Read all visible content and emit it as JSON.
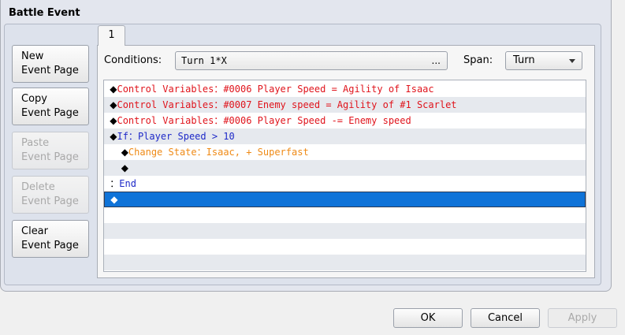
{
  "group_title": "Battle Event",
  "side_buttons": [
    {
      "line1": "New",
      "line2": "Event Page"
    },
    {
      "line1": "Copy",
      "line2": "Event Page"
    },
    {
      "line1": "Paste",
      "line2": "Event Page"
    },
    {
      "line1": "Delete",
      "line2": "Event Page"
    },
    {
      "line1": "Clear",
      "line2": "Event Page"
    }
  ],
  "tab_label": "1",
  "conditions": {
    "label": "Conditions:",
    "value": "Turn 1*X",
    "dots": "..."
  },
  "span": {
    "label": "Span:",
    "value": "Turn"
  },
  "commands": [
    {
      "indent": "",
      "marker": "◆",
      "head": "Control Variables",
      "sep": "：",
      "body": "#0006 Player Speed = Agility of Isaac",
      "color": "red"
    },
    {
      "indent": "",
      "marker": "◆",
      "head": "Control Variables",
      "sep": "：",
      "body": "#0007 Enemy speed = Agility of #1 Scarlet",
      "color": "red"
    },
    {
      "indent": "",
      "marker": "◆",
      "head": "Control Variables",
      "sep": "：",
      "body": "#0006 Player Speed -= Enemy speed",
      "color": "red"
    },
    {
      "indent": "",
      "marker": "◆",
      "head": "If",
      "sep": "：",
      "body": "Player Speed > 10",
      "color": "blue"
    },
    {
      "indent": " ",
      "marker": "◆",
      "head": "Change State",
      "sep": "：",
      "body": "Isaac, + Superfast",
      "color": "orange"
    },
    {
      "indent": " ",
      "marker": "◆",
      "head": "",
      "sep": "",
      "body": "",
      "color": "red"
    },
    {
      "indent": "",
      "marker": "：",
      "head": "End",
      "sep": "",
      "body": "",
      "color": "blue"
    },
    {
      "indent": "",
      "marker": "◆",
      "head": "",
      "sep": "",
      "body": "",
      "color": "red",
      "selected": true
    }
  ],
  "footer": {
    "ok": "OK",
    "cancel": "Cancel",
    "apply": "Apply"
  }
}
